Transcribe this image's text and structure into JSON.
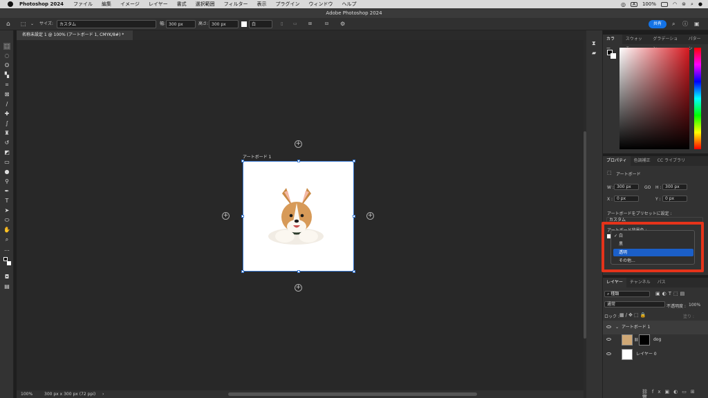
{
  "menubar": {
    "app_name": "Photoshop 2024",
    "items": [
      "ファイル",
      "編集",
      "イメージ",
      "レイヤー",
      "書式",
      "選択範囲",
      "フィルター",
      "表示",
      "プラグイン",
      "ウィンドウ",
      "ヘルプ"
    ],
    "battery": "100%",
    "input_badge": "A"
  },
  "window": {
    "title": "Adobe Photoshop 2024"
  },
  "options_bar": {
    "size_label": "サイズ:",
    "size_value": "カスタム",
    "width_label": "幅:",
    "width_value": "300 px",
    "height_label": "高さ:",
    "height_value": "300 px",
    "color_value": "白",
    "share_label": "共有"
  },
  "document": {
    "tab_title": "名称未設定 1 @ 100% (アートボード 1, CMYK/8#) *"
  },
  "artboard": {
    "title": "アートボード 1"
  },
  "statusbar": {
    "zoom": "100%",
    "doc_info": "300 px x 300 px (72 ppi)"
  },
  "color_panel": {
    "tabs": [
      "カラー",
      "スウォッチ",
      "グラデーション",
      "パターン"
    ],
    "active_tab": "カラー"
  },
  "properties_panel": {
    "tabs": [
      "プロパティ",
      "色調補正",
      "CC ライブラリ"
    ],
    "section": "アートボード",
    "w_label": "W :",
    "w_value": "300 px",
    "h_label": "H :",
    "h_value": "300 px",
    "go_label": "GO",
    "x_label": "X :",
    "x_value": "0 px",
    "y_label": "Y :",
    "y_value": "0 px",
    "preset_label": "アートボードをプリセットに設定 :",
    "preset_value": "カスタム",
    "bg_label": "アートボード背景色 :",
    "bg_options": [
      "白",
      "黒",
      "透明",
      "その他..."
    ],
    "bg_checked": "白",
    "bg_highlighted": "透明"
  },
  "layers_panel": {
    "tabs": [
      "レイヤー",
      "チャンネル",
      "パス"
    ],
    "filter_label": "種類",
    "blend_mode": "通常",
    "opacity_label": "不透明度 :",
    "opacity_value": "100%",
    "lock_label": "ロック :",
    "fill_label": "塗り :",
    "layers": [
      {
        "name": "アートボード 1",
        "type": "artboard"
      },
      {
        "name": "dog",
        "type": "masked"
      },
      {
        "name": "レイヤー 0",
        "type": "pixel"
      }
    ]
  },
  "colors": {
    "accent": "#1473e6",
    "highlight": "#e5331a",
    "selected": "#1b5fc8"
  }
}
